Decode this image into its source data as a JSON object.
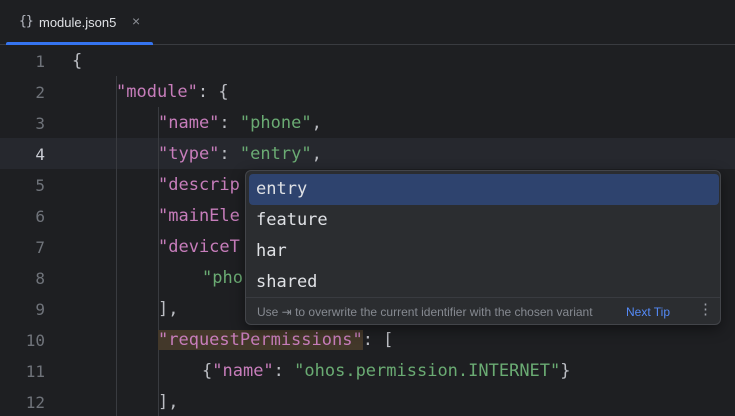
{
  "tab": {
    "icon": "json-braces-icon",
    "icon_glyph": "{}",
    "filename": "module.json5",
    "close_glyph": "×"
  },
  "editor": {
    "current_line": 4,
    "line_numbers": [
      "1",
      "2",
      "3",
      "4",
      "5",
      "6",
      "7",
      "8",
      "9",
      "10",
      "11",
      "12"
    ],
    "lines": [
      {
        "num": "1",
        "tokens": [
          {
            "t": "{",
            "c": "p"
          }
        ]
      },
      {
        "num": "2",
        "tokens": [
          {
            "t": "\"module\"",
            "c": "k"
          },
          {
            "t": ": {",
            "c": "p"
          }
        ]
      },
      {
        "num": "3",
        "tokens": [
          {
            "t": "\"name\"",
            "c": "k"
          },
          {
            "t": ": ",
            "c": "p"
          },
          {
            "t": "\"phone\"",
            "c": "s"
          },
          {
            "t": ",",
            "c": "p"
          }
        ]
      },
      {
        "num": "4",
        "tokens": [
          {
            "t": "\"type\"",
            "c": "k"
          },
          {
            "t": ": ",
            "c": "p"
          },
          {
            "t": "\"entry\"",
            "c": "s"
          },
          {
            "t": ",",
            "c": "p"
          }
        ]
      },
      {
        "num": "5",
        "tokens": [
          {
            "t": "\"descrip",
            "c": "k"
          }
        ]
      },
      {
        "num": "6",
        "tokens": [
          {
            "t": "\"mainEle",
            "c": "k"
          }
        ]
      },
      {
        "num": "7",
        "tokens": [
          {
            "t": "\"deviceT",
            "c": "k"
          }
        ]
      },
      {
        "num": "8",
        "tokens": [
          {
            "t": "\"pho",
            "c": "s"
          }
        ]
      },
      {
        "num": "9",
        "tokens": [
          {
            "t": "],",
            "c": "p"
          }
        ]
      },
      {
        "num": "10",
        "tokens": [
          {
            "t": "\"requestPermissions\"",
            "c": "k"
          },
          {
            "t": ": [",
            "c": "p"
          }
        ]
      },
      {
        "num": "11",
        "tokens": [
          {
            "t": "{",
            "c": "p"
          },
          {
            "t": "\"name\"",
            "c": "k"
          },
          {
            "t": ": ",
            "c": "p"
          },
          {
            "t": "\"ohos.permission.INTERNET\"",
            "c": "s"
          },
          {
            "t": "}",
            "c": "p"
          }
        ]
      },
      {
        "num": "12",
        "tokens": [
          {
            "t": "],",
            "c": "p"
          }
        ]
      }
    ]
  },
  "completion": {
    "items": [
      "entry",
      "feature",
      "har",
      "shared"
    ],
    "selected_index": 0,
    "hint": "Use ⇥ to overwrite the current identifier with the chosen variant",
    "next_tip": "Next Tip",
    "more_glyph": "⋮",
    "more_icon": "more-vertical-icon"
  },
  "colors": {
    "background": "#1e1f22",
    "accent": "#3574f0",
    "key": "#c77dbb",
    "string": "#6aab73",
    "punctuation": "#bcbec4",
    "selection": "#2e436e",
    "link": "#548af7"
  }
}
